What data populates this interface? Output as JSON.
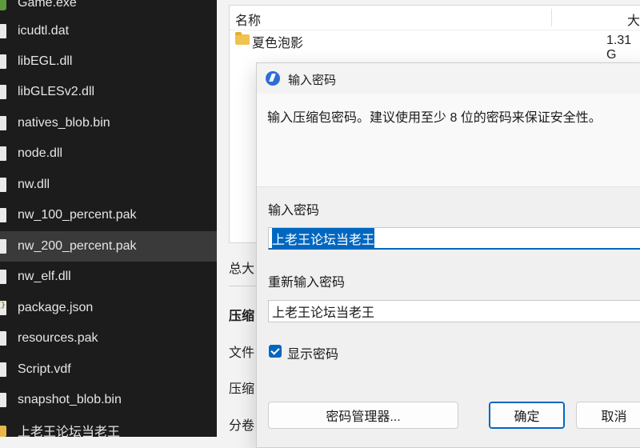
{
  "explorer": {
    "files": [
      {
        "name": "Game.exe",
        "icon": "game-icon"
      },
      {
        "name": "icudtl.dat",
        "icon": "file-icon"
      },
      {
        "name": "libEGL.dll",
        "icon": "file-icon"
      },
      {
        "name": "libGLESv2.dll",
        "icon": "file-icon"
      },
      {
        "name": "natives_blob.bin",
        "icon": "file-icon"
      },
      {
        "name": "node.dll",
        "icon": "file-icon"
      },
      {
        "name": "nw.dll",
        "icon": "file-icon"
      },
      {
        "name": "nw_100_percent.pak",
        "icon": "file-icon"
      },
      {
        "name": "nw_200_percent.pak",
        "icon": "file-icon",
        "selected": true
      },
      {
        "name": "nw_elf.dll",
        "icon": "file-icon"
      },
      {
        "name": "package.json",
        "icon": "json-icon"
      },
      {
        "name": "resources.pak",
        "icon": "file-icon"
      },
      {
        "name": "Script.vdf",
        "icon": "file-icon"
      },
      {
        "name": "snapshot_blob.bin",
        "icon": "file-icon"
      },
      {
        "name": "上老王论坛当老王",
        "icon": "folder-icon"
      }
    ]
  },
  "archive": {
    "col_name": "名称",
    "col_size": "大",
    "rows": [
      {
        "name": "夏色泡影",
        "size": "1.31 G"
      }
    ],
    "side_labels": {
      "total": "总大",
      "compress_heading": "压缩",
      "file": "文件",
      "compress": "压缩",
      "split": "分卷"
    }
  },
  "dialog": {
    "title": "输入密码",
    "instruction": "输入压缩包密码。建议使用至少 8 位的密码来保证安全性。",
    "password_label": "输入密码",
    "password_value": "上老王论坛当老王",
    "reenter_label": "重新输入密码",
    "reenter_value": "上老王论坛当老王",
    "show_password_label": "显示密码",
    "show_password_checked": true,
    "manager_button": "密码管理器...",
    "ok_button": "确定",
    "cancel_button": "取消"
  },
  "colors": {
    "accent": "#0067c0",
    "explorer_bg": "#1c1c1c",
    "selected_row": "#3a3a3a"
  }
}
